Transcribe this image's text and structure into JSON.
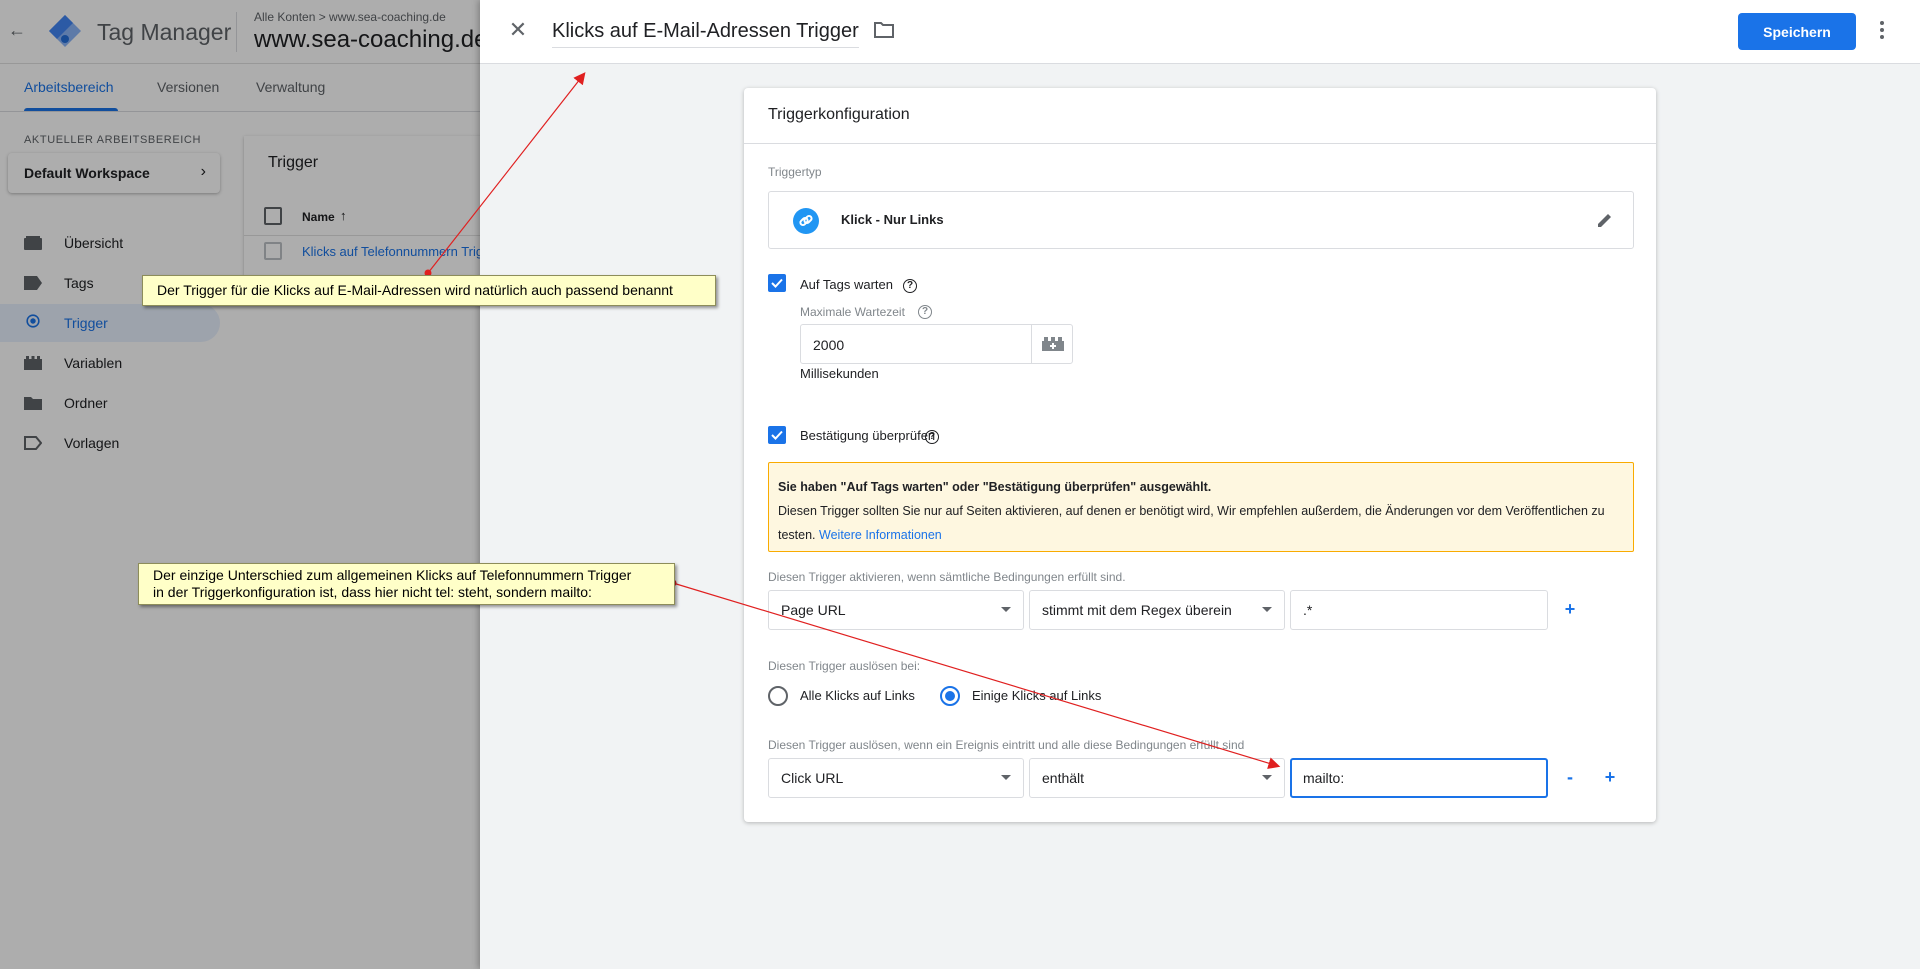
{
  "app": {
    "product_name": "Tag Manager",
    "breadcrumb": "Alle Konten  >  www.sea-coaching.de",
    "container_name": "www.sea-coaching.de",
    "tabs": [
      "Arbeitsbereich",
      "Versionen",
      "Verwaltung"
    ],
    "workspace_label": "AKTUELLER ARBEITSBEREICH",
    "workspace_name": "Default Workspace",
    "nav": [
      "Übersicht",
      "Tags",
      "Trigger",
      "Variablen",
      "Ordner",
      "Vorlagen"
    ],
    "triggers_title": "Trigger",
    "triggers_col_name": "Name",
    "triggers_row": "Klicks auf Telefonnummern Trigger"
  },
  "editor": {
    "trigger_name": "Klicks auf E-Mail-Adressen Trigger",
    "save_label": "Speichern",
    "card_title": "Triggerkonfiguration",
    "type_label_heading": "Triggertyp",
    "type_name": "Klick - Nur Links",
    "wait_tags_label": "Auf Tags warten",
    "max_wait_label": "Maximale Wartezeit",
    "max_wait_value": "2000",
    "unit_label": "Millisekunden",
    "check_validation_label": "Bestätigung überprüfen",
    "warning_title": "Sie haben \"Auf Tags warten\" oder \"Bestätigung überprüfen\" ausgewählt.",
    "warning_text": "Diesen Trigger sollten Sie nur auf Seiten aktivieren, auf denen er benötigt wird, Wir empfehlen außerdem, die Änderungen vor dem Veröffentlichen zu testen.",
    "warning_link": "Weitere Informationen",
    "enable_when_label": "Diesen Trigger aktivieren, wenn sämtliche Bedingungen erfüllt sind.",
    "enable_condition": {
      "variable": "Page URL",
      "operator": "stimmt mit dem Regex überein",
      "value": ".*"
    },
    "fire_on_label": "Diesen Trigger auslösen bei:",
    "fire_on_options": [
      "Alle Klicks auf Links",
      "Einige Klicks auf Links"
    ],
    "fire_on_selected": "Einige Klicks auf Links",
    "fire_when_label": "Diesen Trigger auslösen, wenn ein Ereignis eintritt und alle diese Bedingungen erfüllt sind",
    "fire_condition": {
      "variable": "Click URL",
      "operator": "enthält",
      "value": "mailto:"
    },
    "minus_label": "-",
    "plus_label": "+"
  },
  "annotations": {
    "note1": "Der Trigger für die Klicks auf E-Mail-Adressen wird natürlich auch passend benannt",
    "note2_line1": "Der einzige Unterschied zum allgemeinen Klicks auf Telefonnummern Trigger",
    "note2_line2": "in der Triggerkonfiguration ist, dass hier nicht tel: steht, sondern mailto:"
  },
  "colors": {
    "accent": "#1a73e8",
    "note_bg": "#ffffc8",
    "arrow": "#e02020",
    "warning_bg": "#fef7e0"
  }
}
